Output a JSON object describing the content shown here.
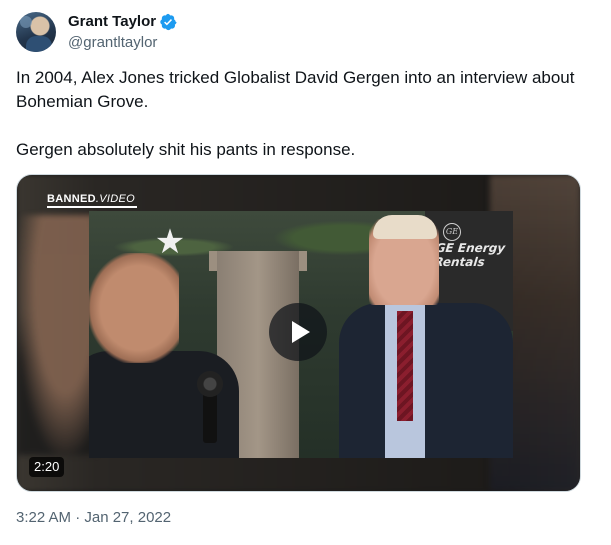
{
  "author": {
    "display_name": "Grant Taylor",
    "handle": "@grantltaylor",
    "verified": true,
    "verified_icon": "verified-badge-icon",
    "verified_color": "#1d9bf0"
  },
  "tweet": {
    "paragraphs": [
      "In 2004, Alex Jones tricked Globalist David Gergen into an interview about Bohemian Grove.",
      "Gergen absolutely shit his pants in response."
    ],
    "timestamp": "3:22 AM · Jan 27, 2022"
  },
  "media": {
    "type": "video",
    "duration": "2:20",
    "watermark_bold": "BANNED",
    "watermark_italic": ".VIDEO",
    "sign_text": "GE Energy Rentals",
    "sign_logo": "GE",
    "play_icon": "play-icon"
  },
  "colors": {
    "text_primary": "#0f1419",
    "text_secondary": "#536471",
    "border": "#cfd9de"
  }
}
